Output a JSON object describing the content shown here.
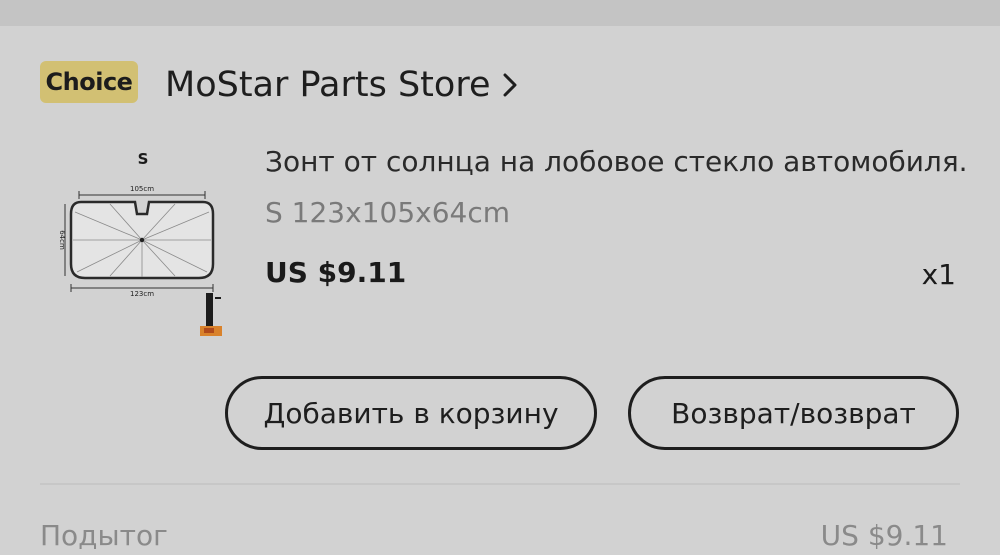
{
  "store": {
    "badge": "Choice",
    "name": "MoStar Parts Store",
    "badge_color": "#d2c073"
  },
  "item": {
    "image": {
      "size_label": "S",
      "width_top": "105cm",
      "width_bottom": "123cm",
      "height": "64cm"
    },
    "title": "Зонт от солнца на лобовое стекло автомобиля...",
    "variant": "S 123x105x64cm",
    "price": "US $9.11",
    "quantity": "x1"
  },
  "actions": {
    "add_to_cart": "Добавить в корзину",
    "return": "Возврат/возврат"
  },
  "summary": {
    "subtotal_label": "Подытог",
    "subtotal_value": "US $9.11"
  },
  "icons": {
    "store_link": "chevron-right-icon"
  }
}
